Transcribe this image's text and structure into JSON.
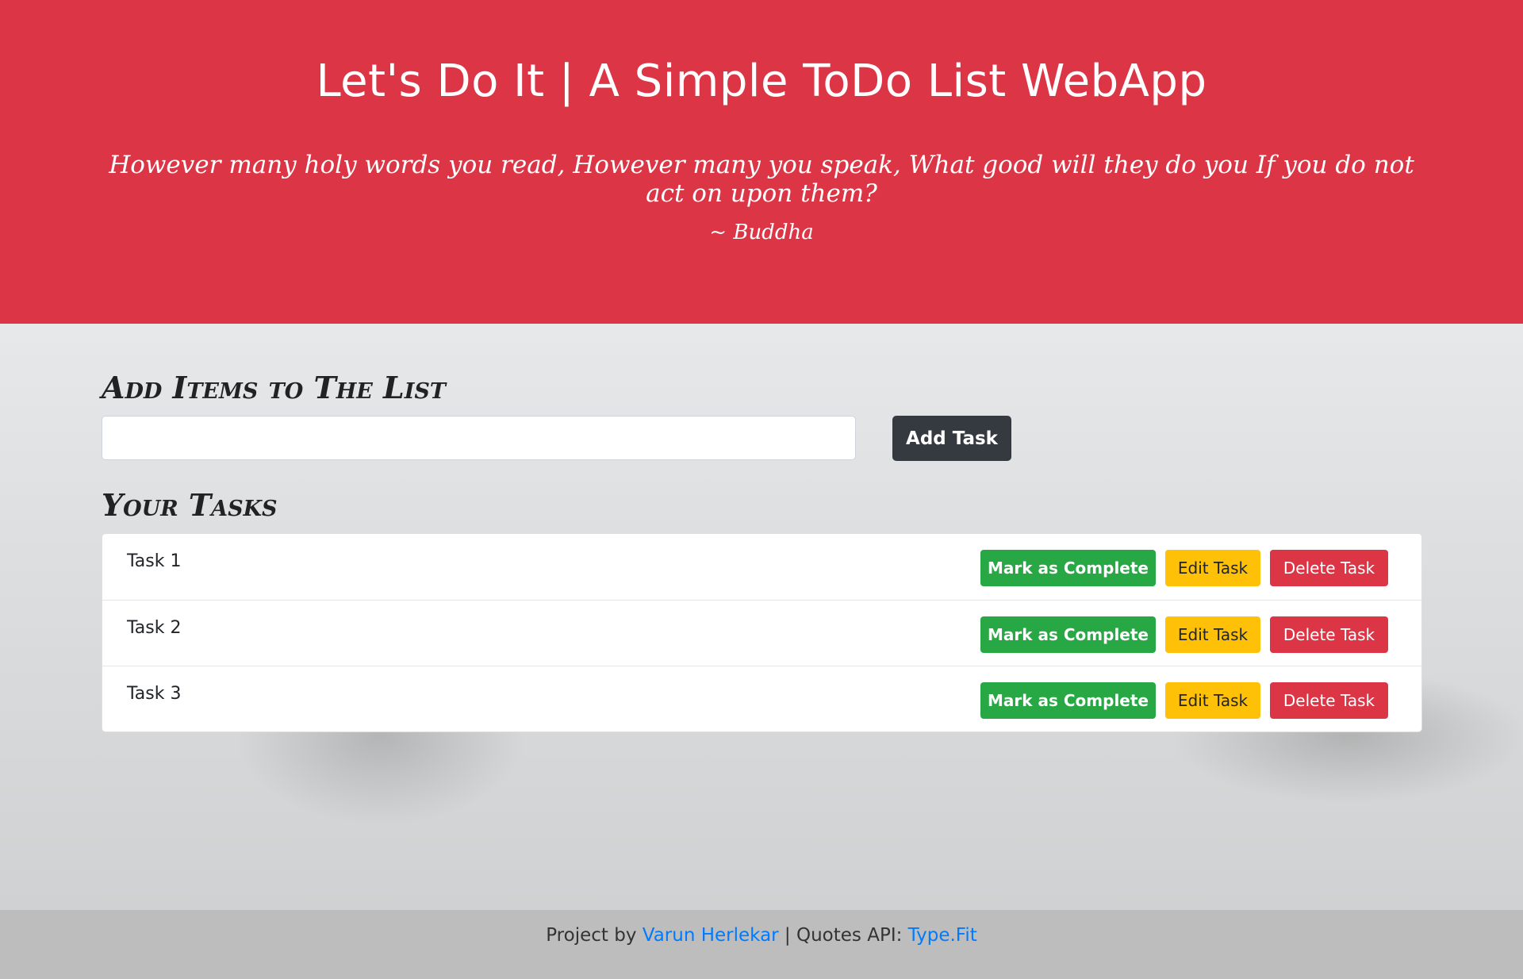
{
  "header": {
    "title": "Let's Do It | A Simple ToDo List WebApp",
    "quote": "However many holy words you read, However many you speak, What good will they do you If you do not act on upon them?",
    "author": "~ Buddha"
  },
  "add_section": {
    "heading": "Add Items to The List",
    "input_value": "",
    "input_placeholder": "",
    "button_label": "Add Task"
  },
  "tasks_section": {
    "heading": "Your Tasks",
    "tasks": [
      {
        "label": "Task 1",
        "complete_label": "Mark as Complete",
        "edit_label": "Edit Task",
        "delete_label": "Delete Task"
      },
      {
        "label": "Task 2",
        "complete_label": "Mark as Complete",
        "edit_label": "Edit Task",
        "delete_label": "Delete Task"
      },
      {
        "label": "Task 3",
        "complete_label": "Mark as Complete",
        "edit_label": "Edit Task",
        "delete_label": "Delete Task"
      }
    ]
  },
  "footer": {
    "prefix": "Project by ",
    "author_link": "Varun Herlekar",
    "separator": " | Quotes API: ",
    "api_link": "Type.Fit"
  },
  "colors": {
    "header_bg": "#dc3545",
    "complete": "#28a745",
    "edit": "#ffc107",
    "delete": "#dc3545",
    "add_button": "#343a40",
    "link": "#007bff"
  }
}
